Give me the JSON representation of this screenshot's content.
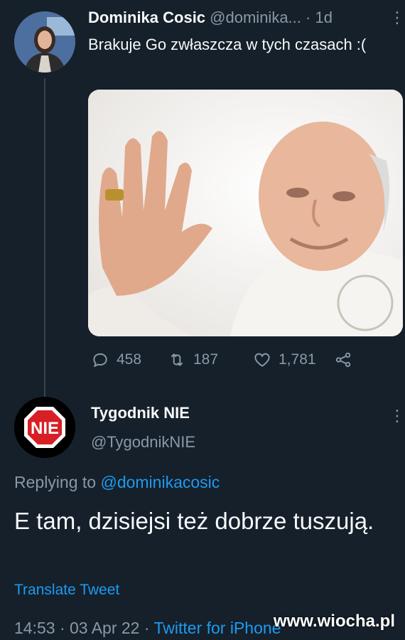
{
  "tweet1": {
    "name": "Dominika Cosic",
    "handle": "@dominika...",
    "separator": "·",
    "time": "1d",
    "text": "Brakuje Go zwłaszcza w tych czasach :(",
    "stats": {
      "replies": "458",
      "retweets": "187",
      "likes": "1,781"
    }
  },
  "tweet2": {
    "name": "Tygodnik NIE",
    "handle": "@TygodnikNIE",
    "avatar_text": "NIE",
    "replying_prefix": "Replying to",
    "replying_to": "@dominikacosic",
    "text": "E tam, dzisiejsi też dobrze tuszują.",
    "translate": "Translate Tweet",
    "timestamp": "14:53 · 03 Apr 22 ·",
    "source": "Twitter for iPhone"
  },
  "watermark": "www.wiocha.pl",
  "colors": {
    "background": "#15202b",
    "link": "#1d9bf0",
    "muted": "#8b98a5",
    "stop_sign": "#d91f26"
  }
}
